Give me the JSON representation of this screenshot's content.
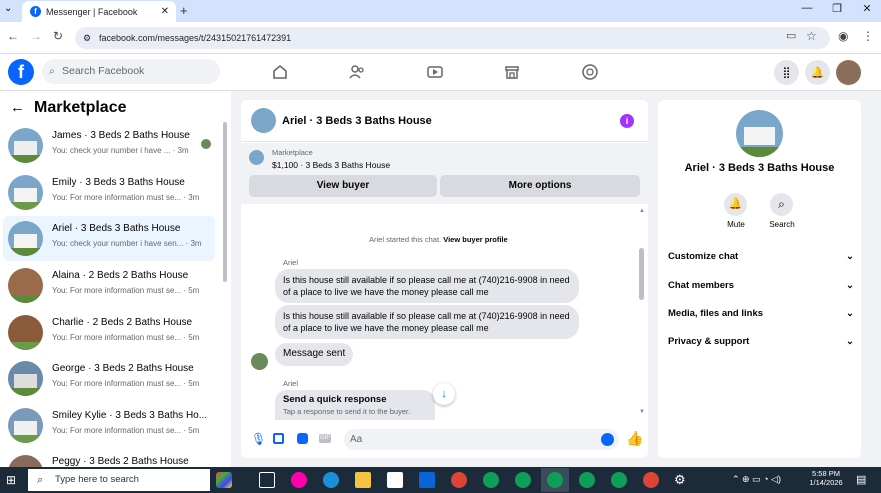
{
  "browser": {
    "tab_title": "Messenger | Facebook",
    "url": "facebook.com/messages/t/24315021761472391"
  },
  "header": {
    "search_placeholder": "Search Facebook"
  },
  "left": {
    "title": "Marketplace",
    "conversations": [
      {
        "name": "James · 3 Beds 2 Baths House",
        "preview": "You: check your number i have ... · 3m"
      },
      {
        "name": "Emily · 3 Beds 3 Baths House",
        "preview": "You: For more information must se... · 3m"
      },
      {
        "name": "Ariel · 3 Beds 3 Baths House",
        "preview": "You: check your number i have sen... · 3m"
      },
      {
        "name": "Alaina · 2 Beds 2 Baths House",
        "preview": "You: For more information must se... · 5m"
      },
      {
        "name": "Charlie · 2 Beds 2 Baths House",
        "preview": "You: For more information must se... · 5m"
      },
      {
        "name": "George · 3 Beds 2 Baths House",
        "preview": "You: For more information must se... · 5m"
      },
      {
        "name": "Smiley Kylie · 3 Beds 3 Baths Ho...",
        "preview": "You: For more information must se... · 5m"
      },
      {
        "name": "Peggy · 3 Beds 2 Baths House",
        "preview": ""
      }
    ]
  },
  "chat": {
    "title": "Ariel · 3 Beds 3 Baths House",
    "marketplace_label": "Marketplace",
    "listing": "$1,100 · 3 Beds 3 Baths House",
    "view_buyer": "View buyer",
    "more_options": "More options",
    "started_prefix": "Ariel started this chat.",
    "view_buyer_profile": "View buyer profile",
    "sender1": "Ariel",
    "msg1": "Is this house still available if so please call me at (740)216-9908 in need of a place to live we have the money please call me",
    "msg2": "Is this house still available if so please call me at (740)216-9908 in need of a place to live we have the money please call me",
    "msg3": "Message sent",
    "sender2": "Ariel",
    "quick_title": "Send a quick response",
    "quick_sub": "Tap a response to send it to the buyer.",
    "input_placeholder": "Aa"
  },
  "right": {
    "name": "Ariel · 3 Beds 3 Baths House",
    "mute": "Mute",
    "search": "Search",
    "items": [
      "Customize chat",
      "Chat members",
      "Media, files and links",
      "Privacy & support"
    ]
  },
  "taskbar": {
    "search": "Type here to search",
    "time": "5:58 PM",
    "date": "1/14/2026"
  }
}
